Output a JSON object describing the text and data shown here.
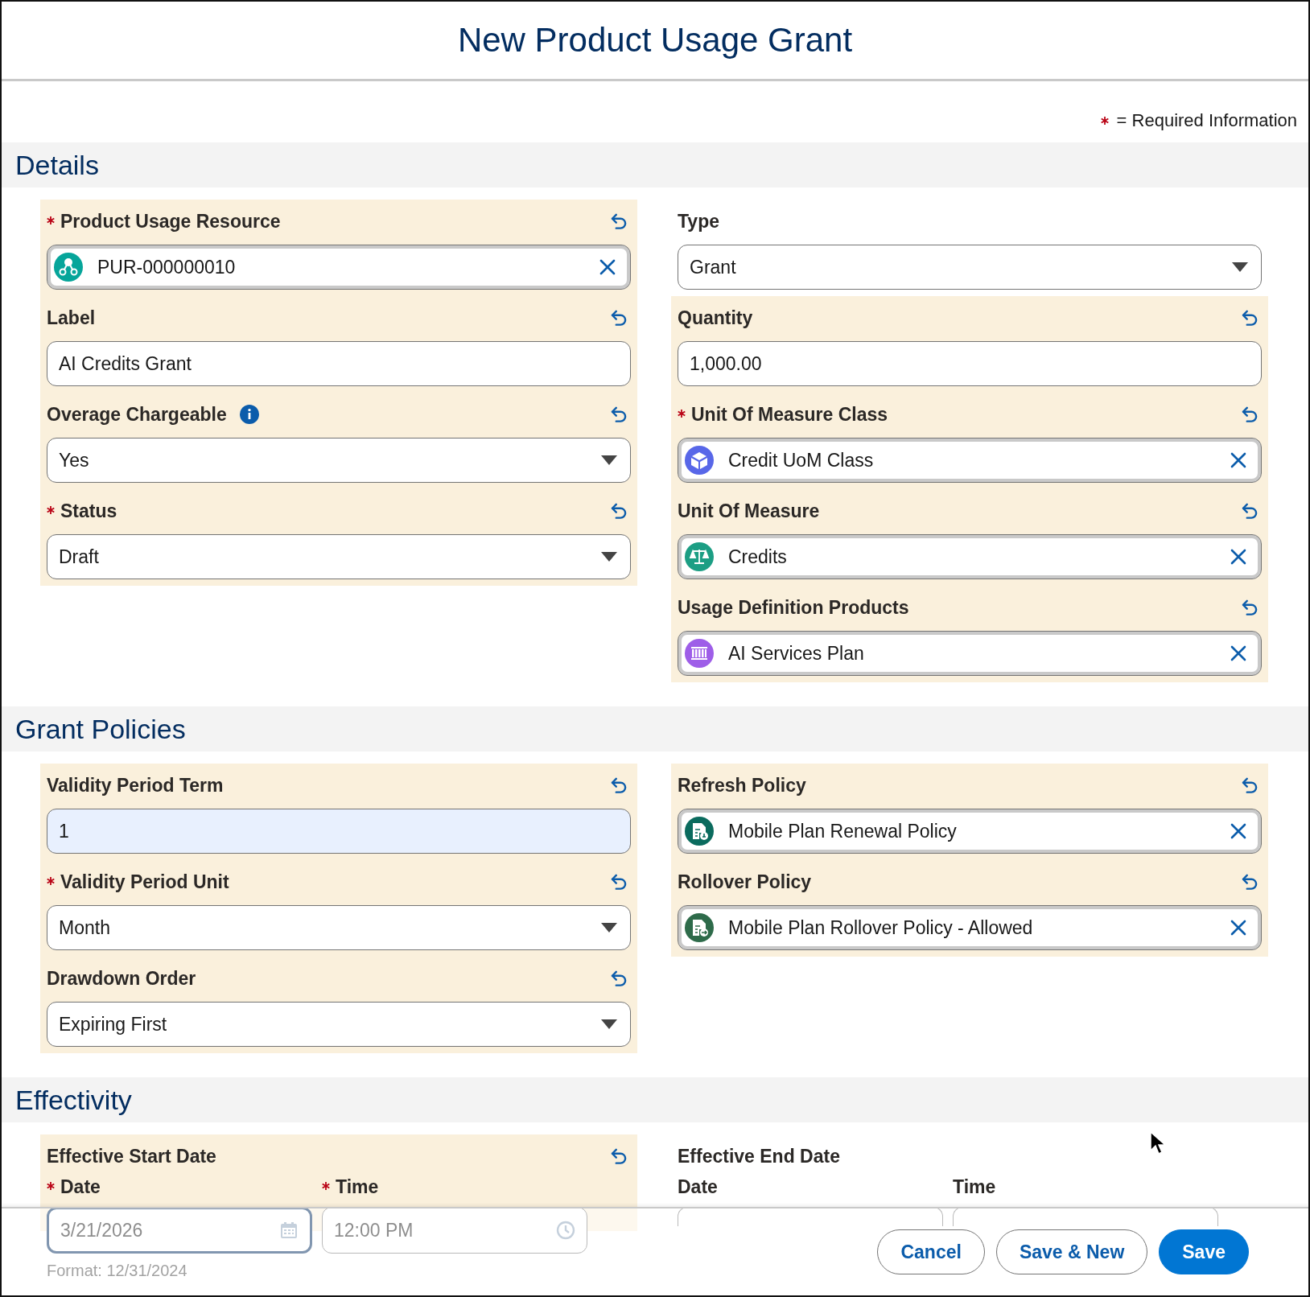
{
  "title": "New Product Usage Grant",
  "required_legend": "= Required Information",
  "sections": [
    {
      "title": "Details",
      "columns": [
        [
          {
            "kind": "lookup",
            "label": "Product Usage Resource",
            "required": true,
            "edited": true,
            "value": "PUR-000000010",
            "icon": {
              "kind": "network",
              "color": "#06a59a"
            }
          },
          {
            "kind": "text",
            "label": "Label",
            "required": false,
            "edited": true,
            "value": "AI Credits Grant"
          },
          {
            "kind": "picklist",
            "label": "Overage Chargeable",
            "required": false,
            "edited": true,
            "info": true,
            "value": "Yes"
          },
          {
            "kind": "picklist",
            "label": "Status",
            "required": true,
            "edited": true,
            "value": "Draft"
          }
        ],
        [
          {
            "kind": "picklist",
            "label": "Type",
            "required": false,
            "edited": false,
            "value": "Grant"
          },
          {
            "kind": "text",
            "label": "Quantity",
            "required": false,
            "edited": true,
            "value": "1,000.00"
          },
          {
            "kind": "lookup",
            "label": "Unit Of Measure Class",
            "required": true,
            "edited": true,
            "value": "Credit UoM Class",
            "icon": {
              "kind": "cube",
              "color": "#5867e8"
            }
          },
          {
            "kind": "lookup",
            "label": "Unit Of Measure",
            "required": false,
            "edited": true,
            "value": "Credits",
            "icon": {
              "kind": "scale",
              "color": "#1c9e84"
            }
          },
          {
            "kind": "lookup",
            "label": "Usage Definition Products",
            "required": false,
            "edited": true,
            "value": "AI Services Plan",
            "icon": {
              "kind": "barcode",
              "color": "#9e5ee8"
            }
          }
        ]
      ]
    },
    {
      "title": "Grant Policies",
      "columns": [
        [
          {
            "kind": "text",
            "label": "Validity Period Term",
            "required": false,
            "edited": true,
            "autofilled": true,
            "value": "1"
          },
          {
            "kind": "picklist",
            "label": "Validity Period Unit",
            "required": true,
            "edited": true,
            "value": "Month"
          },
          {
            "kind": "picklist",
            "label": "Drawdown Order",
            "required": false,
            "edited": true,
            "value": "Expiring First"
          }
        ],
        [
          {
            "kind": "lookup",
            "label": "Refresh Policy",
            "required": false,
            "edited": true,
            "value": "Mobile Plan Renewal Policy",
            "icon": {
              "kind": "policy",
              "color": "#0b6b5e"
            }
          },
          {
            "kind": "lookup",
            "label": "Rollover Policy",
            "required": false,
            "edited": true,
            "value": "Mobile Plan Rollover Policy - Allowed",
            "icon": {
              "kind": "policy-arrow",
              "color": "#2e6b4a"
            }
          }
        ]
      ]
    },
    {
      "title": "Effectivity",
      "columns": [
        [
          {
            "kind": "datetime",
            "label": "Effective Start Date",
            "required": false,
            "edited": true,
            "parts": [
              {
                "kind": "date",
                "label": "Date",
                "required": true,
                "focused": true,
                "value": "3/21/2026",
                "help": "Format: 12/31/2024"
              },
              {
                "kind": "time",
                "label": "Time",
                "required": true,
                "focused": false,
                "value": "12:00 PM"
              }
            ]
          }
        ],
        [
          {
            "kind": "datetime",
            "label": "Effective End Date",
            "required": false,
            "edited": false,
            "parts": [
              {
                "kind": "date",
                "label": "Date",
                "required": false,
                "focused": false
              },
              {
                "kind": "time",
                "label": "Time",
                "required": false,
                "focused": false
              }
            ]
          }
        ]
      ]
    }
  ],
  "buttons": [
    {
      "label": "Cancel",
      "kind": "neutral"
    },
    {
      "label": "Save & New",
      "kind": "neutral"
    },
    {
      "label": "Save",
      "kind": "brand"
    }
  ]
}
